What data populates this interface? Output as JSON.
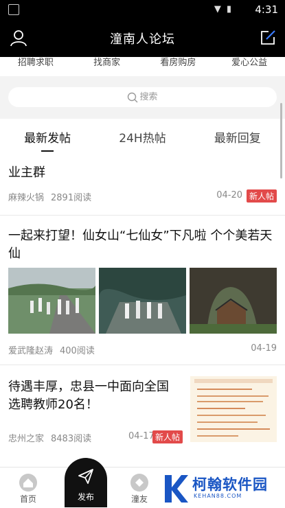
{
  "status_bar": {
    "time": "4:31"
  },
  "app_bar": {
    "title": "潼南人论坛"
  },
  "categories": [
    "招聘求职",
    "找商家",
    "看房购房",
    "爱心公益"
  ],
  "search": {
    "placeholder": "搜索"
  },
  "tabs": [
    "最新发帖",
    "24H热帖",
    "最新回复"
  ],
  "active_tab": "最新发帖",
  "posts": [
    {
      "title": "业主群",
      "author": "麻辣火锅",
      "reads": "2891阅读",
      "date": "04-20",
      "badge": "新人帖"
    },
    {
      "title_line1": "一起来打望！仙女山“七仙女”下凡啦 个个美若天",
      "title_line2": "仙",
      "author": "爱武隆赵涛",
      "reads": "400阅读",
      "date": "04-19"
    },
    {
      "title_line1": "待遇丰厚，忠县一中面向全国",
      "title_line2": "选聘教师20名！",
      "author": "忠州之家",
      "reads": "8483阅读",
      "date": "04-17",
      "badge": "新人帖"
    }
  ],
  "bottom_nav": {
    "home": "首页",
    "publish": "发布",
    "friends": "潼友"
  },
  "watermark": {
    "name": "柯翰软件园",
    "url": "KEHAN88.COM"
  },
  "colors": {
    "bar": "#000000",
    "badge": "#e24a4a",
    "accent_blue": "#1a56c4"
  }
}
